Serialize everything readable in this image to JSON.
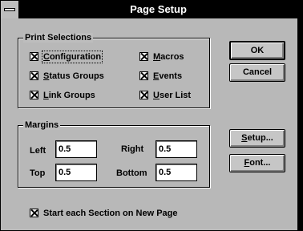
{
  "window": {
    "title": "Page Setup"
  },
  "print_selections": {
    "legend": "Print Selections",
    "items": [
      {
        "pre": "",
        "key": "C",
        "rest": "onfiguration",
        "checked": true
      },
      {
        "pre": "",
        "key": "S",
        "rest": "tatus Groups",
        "checked": true
      },
      {
        "pre": "",
        "key": "L",
        "rest": "ink Groups",
        "checked": true
      },
      {
        "pre": "",
        "key": "M",
        "rest": "acros",
        "checked": true
      },
      {
        "pre": "",
        "key": "E",
        "rest": "vents",
        "checked": true
      },
      {
        "pre": "",
        "key": "U",
        "rest": "ser List",
        "checked": true
      }
    ]
  },
  "margins": {
    "legend": "Margins",
    "left_label": "Left",
    "left_value": "0.5",
    "right_label": "Right",
    "right_value": "0.5",
    "top_label": "Top",
    "top_value": "0.5",
    "bottom_label": "Bottom",
    "bottom_value": "0.5"
  },
  "buttons": {
    "ok": "OK",
    "cancel": "Cancel",
    "setup_key": "S",
    "setup_rest": "etup...",
    "font_key": "F",
    "font_rest": "ont..."
  },
  "new_page": {
    "label": "Start each Section on New Page",
    "checked": true
  }
}
